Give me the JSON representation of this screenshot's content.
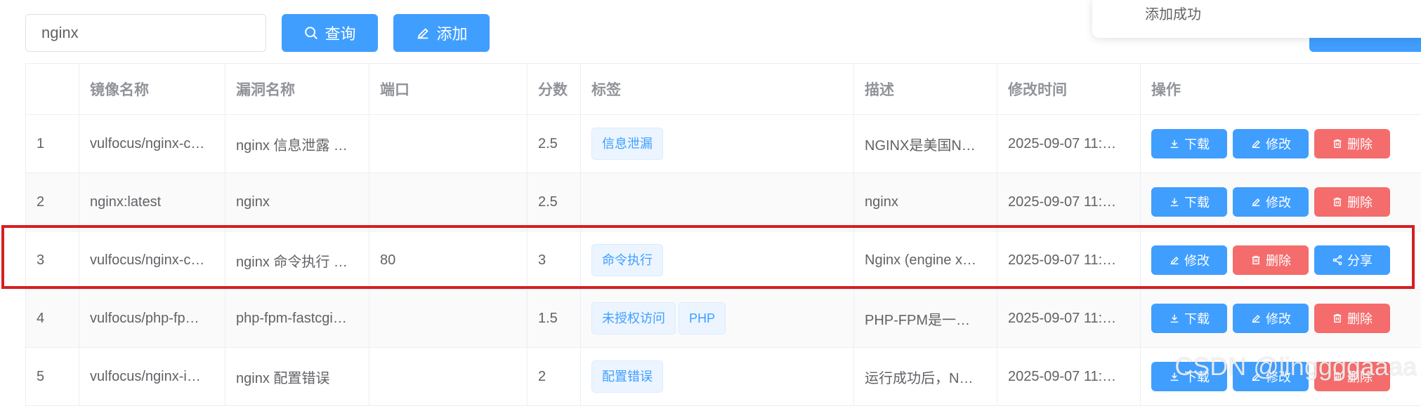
{
  "toolbar": {
    "search_value": "nginx",
    "query_label": "查询",
    "add_label": "添加"
  },
  "notification": {
    "message": "添加成功"
  },
  "table": {
    "headers": [
      "",
      "镜像名称",
      "漏洞名称",
      "端口",
      "分数",
      "标签",
      "描述",
      "修改时间",
      "操作"
    ],
    "rows": [
      {
        "index": "1",
        "image": "vulfocus/nginx-c…",
        "vuln": "nginx 信息泄露 …",
        "port": "",
        "score": "2.5",
        "tags": [
          "信息泄漏"
        ],
        "desc": "NGINX是美国N…",
        "time": "2025-09-07 11:…",
        "actions": [
          "download",
          "edit",
          "delete"
        ]
      },
      {
        "index": "2",
        "image": "nginx:latest",
        "vuln": "nginx",
        "port": "",
        "score": "2.5",
        "tags": [],
        "desc": "nginx",
        "time": "2025-09-07 11:…",
        "actions": [
          "download",
          "edit",
          "delete"
        ]
      },
      {
        "index": "3",
        "image": "vulfocus/nginx-c…",
        "vuln": "nginx 命令执行 …",
        "port": "80",
        "score": "3",
        "tags": [
          "命令执行"
        ],
        "desc": "Nginx (engine x…",
        "time": "2025-09-07 11:…",
        "actions": [
          "edit",
          "delete",
          "share"
        ]
      },
      {
        "index": "4",
        "image": "vulfocus/php-fp…",
        "vuln": "php-fpm-fastcgi…",
        "port": "",
        "score": "1.5",
        "tags": [
          "未授权访问",
          "PHP"
        ],
        "desc": "PHP-FPM是一…",
        "time": "2025-09-07 11:…",
        "actions": [
          "download",
          "edit",
          "delete"
        ]
      },
      {
        "index": "5",
        "image": "vulfocus/nginx-i…",
        "vuln": "nginx 配置错误",
        "port": "",
        "score": "2",
        "tags": [
          "配置错误"
        ],
        "desc": "运行成功后，N…",
        "time": "2025-09-07 11:…",
        "actions": [
          "download",
          "edit",
          "delete"
        ]
      }
    ],
    "action_labels": {
      "download": "下载",
      "edit": "修改",
      "delete": "删除",
      "share": "分享"
    }
  },
  "watermark": "CSDN @linggggaaaa",
  "colors": {
    "primary": "#409eff",
    "danger": "#f56c6c",
    "highlight": "#d42020"
  }
}
